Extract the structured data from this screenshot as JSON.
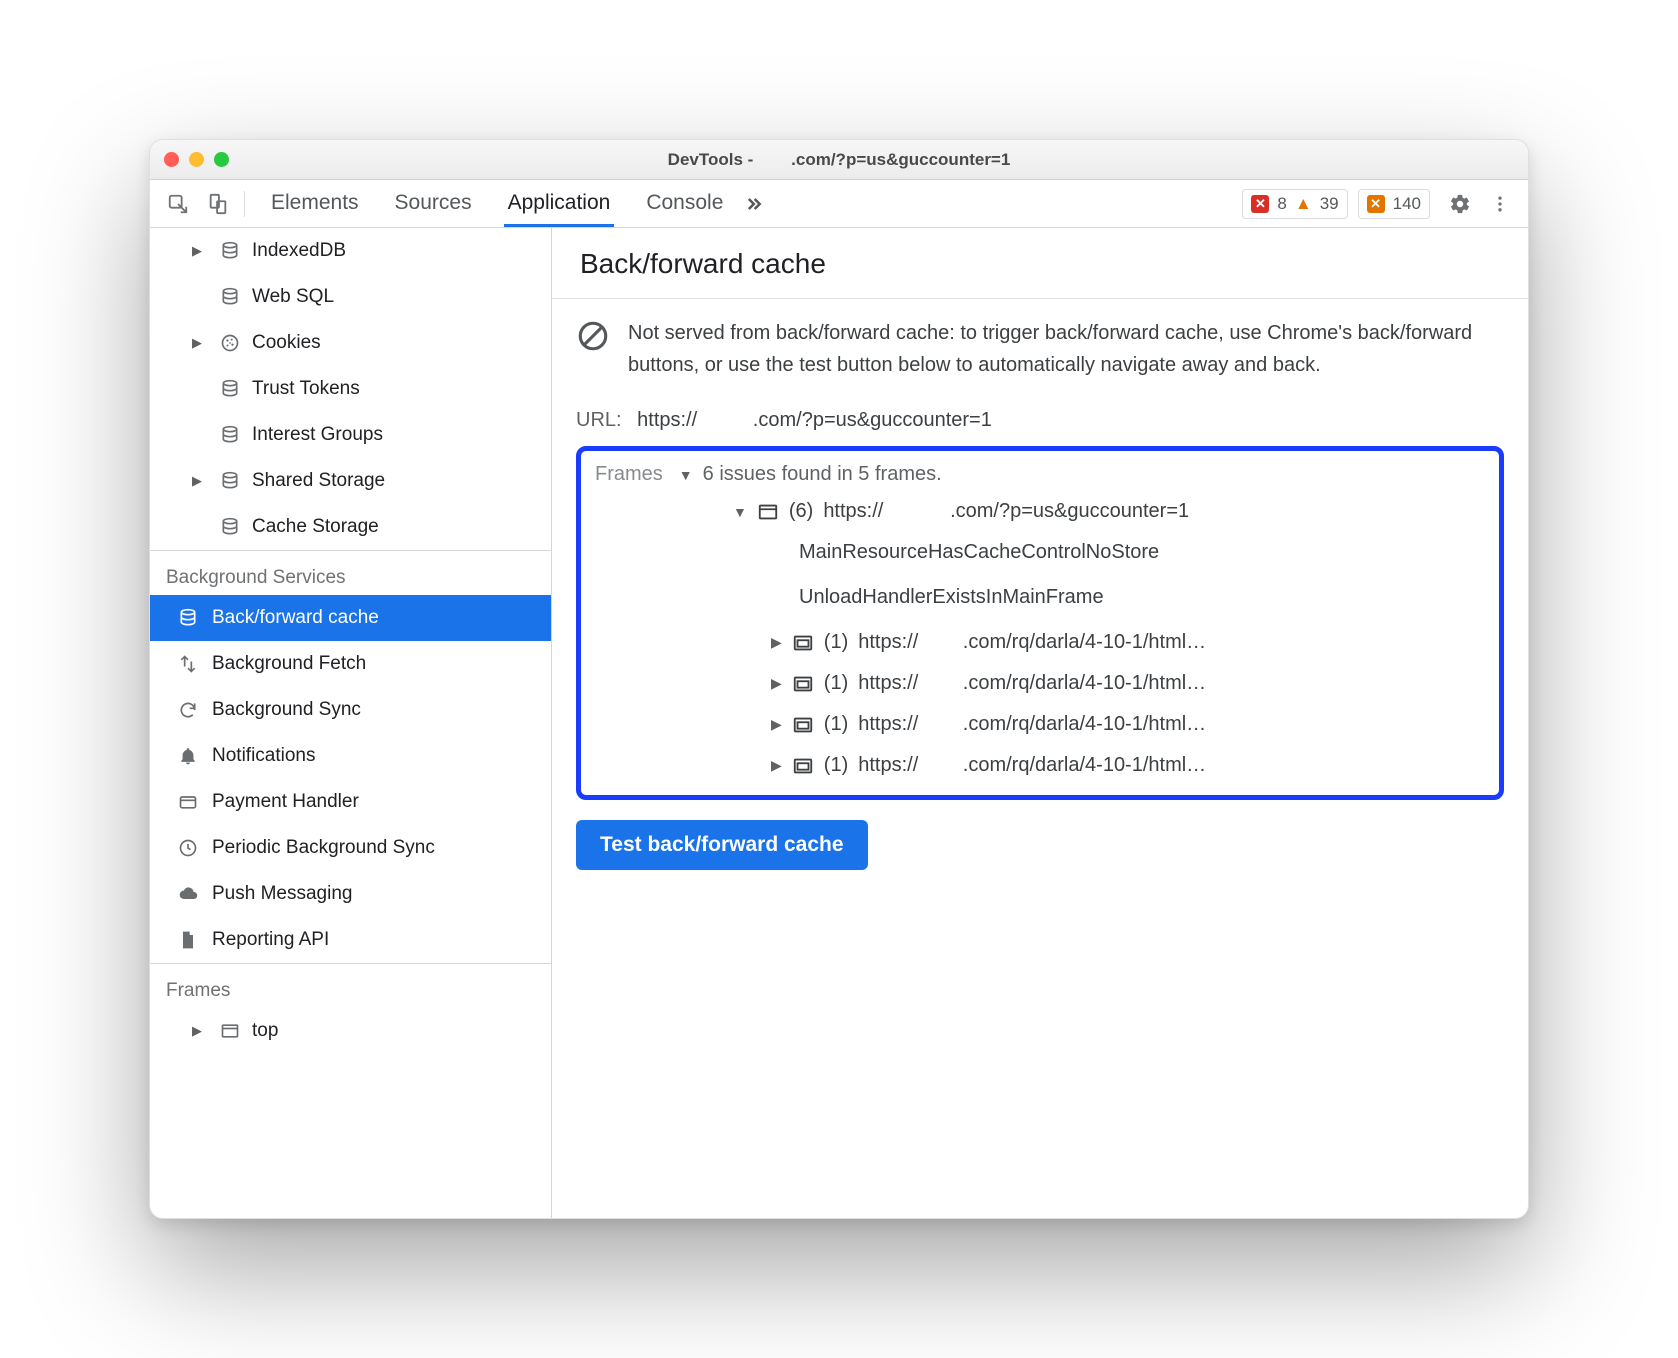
{
  "window": {
    "title_prefix": "DevTools -",
    "title_suffix": ".com/?p=us&guccounter=1"
  },
  "toolbar": {
    "tabs": [
      "Elements",
      "Sources",
      "Application",
      "Console"
    ],
    "active_tab": 2,
    "errors_count": "8",
    "warnings_count": "39",
    "issues_count": "140"
  },
  "sidebar": {
    "storage": [
      {
        "label": "IndexedDB",
        "expandable": true,
        "icon": "db"
      },
      {
        "label": "Web SQL",
        "expandable": false,
        "icon": "db"
      },
      {
        "label": "Cookies",
        "expandable": true,
        "icon": "cookie"
      },
      {
        "label": "Trust Tokens",
        "expandable": false,
        "icon": "db"
      },
      {
        "label": "Interest Groups",
        "expandable": false,
        "icon": "db"
      },
      {
        "label": "Shared Storage",
        "expandable": true,
        "icon": "db"
      },
      {
        "label": "Cache Storage",
        "expandable": false,
        "icon": "db"
      }
    ],
    "bg_section": "Background Services",
    "services": [
      {
        "label": "Back/forward cache",
        "icon": "db",
        "selected": true
      },
      {
        "label": "Background Fetch",
        "icon": "transfer",
        "selected": false
      },
      {
        "label": "Background Sync",
        "icon": "sync",
        "selected": false
      },
      {
        "label": "Notifications",
        "icon": "bell",
        "selected": false
      },
      {
        "label": "Payment Handler",
        "icon": "card",
        "selected": false
      },
      {
        "label": "Periodic Background Sync",
        "icon": "clock",
        "selected": false
      },
      {
        "label": "Push Messaging",
        "icon": "cloud",
        "selected": false
      },
      {
        "label": "Reporting API",
        "icon": "file",
        "selected": false
      }
    ],
    "frames_section": "Frames",
    "frames": [
      {
        "label": "top"
      }
    ]
  },
  "panel": {
    "heading": "Back/forward cache",
    "notice": "Not served from back/forward cache: to trigger back/forward cache, use Chrome's back/forward buttons, or use the test button below to automatically navigate away and back.",
    "url_label": "URL:",
    "url_prefix": "https://",
    "url_suffix": ".com/?p=us&guccounter=1",
    "frames_label": "Frames",
    "frames_summary": "6 issues found in 5 frames.",
    "root_frame": {
      "count": "(6)",
      "url_prefix": "https://",
      "url_suffix": ".com/?p=us&guccounter=1",
      "reasons": [
        "MainResourceHasCacheControlNoStore",
        "UnloadHandlerExistsInMainFrame"
      ]
    },
    "sub_frames": [
      {
        "count": "(1)",
        "url_prefix": "https://",
        "url_suffix": ".com/rq/darla/4-10-1/html…"
      },
      {
        "count": "(1)",
        "url_prefix": "https://",
        "url_suffix": ".com/rq/darla/4-10-1/html…"
      },
      {
        "count": "(1)",
        "url_prefix": "https://",
        "url_suffix": ".com/rq/darla/4-10-1/html…"
      },
      {
        "count": "(1)",
        "url_prefix": "https://",
        "url_suffix": ".com/rq/darla/4-10-1/html…"
      }
    ],
    "test_button": "Test back/forward cache"
  }
}
